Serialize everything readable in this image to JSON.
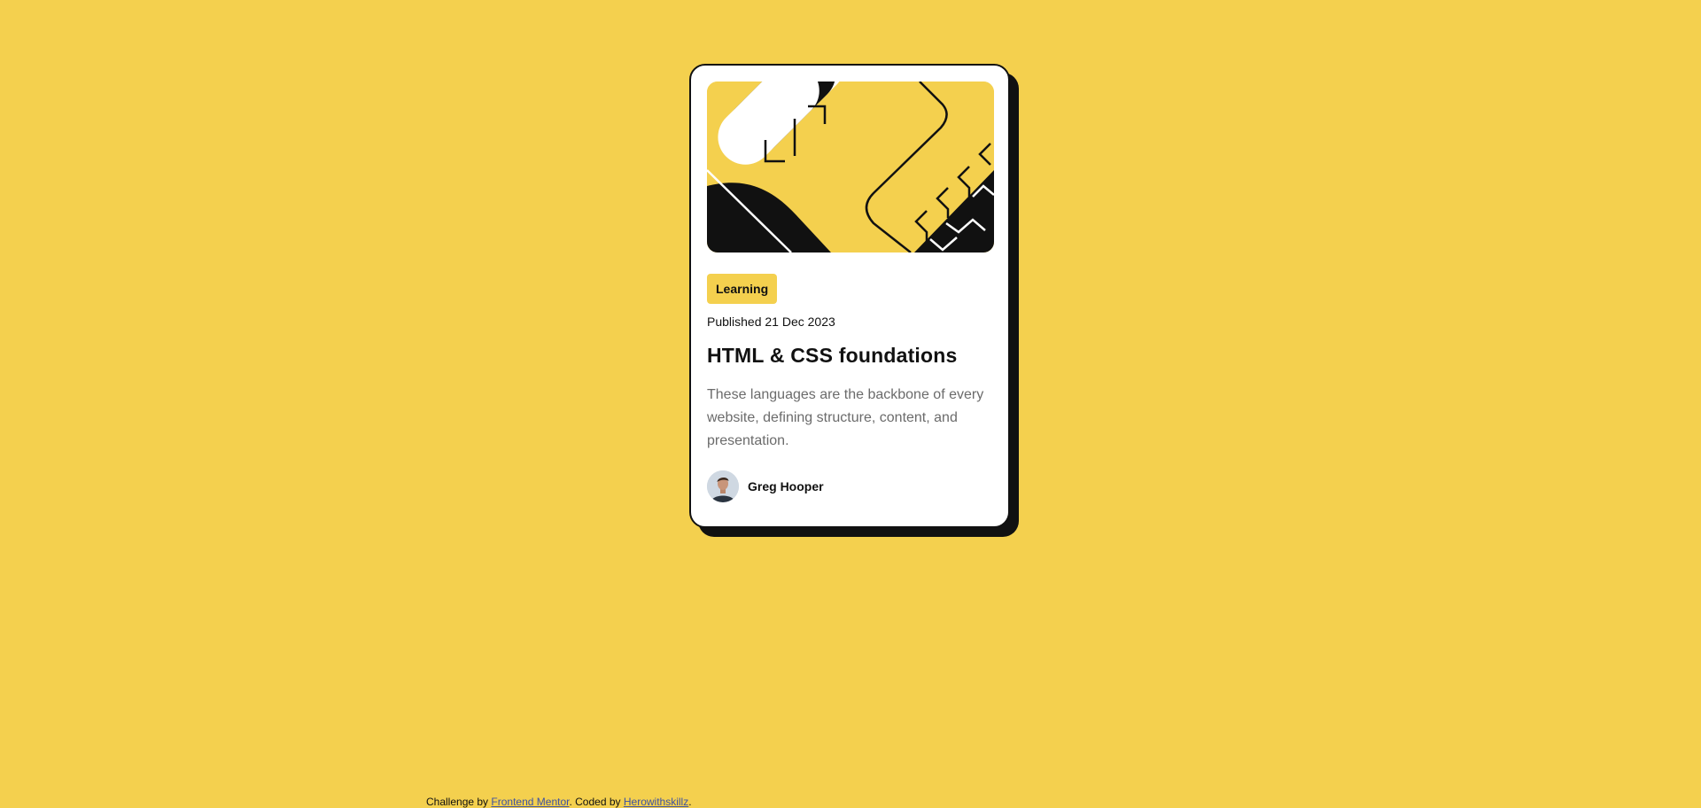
{
  "card": {
    "tag": "Learning",
    "published": "Published 21 Dec 2023",
    "title": "HTML & CSS foundations",
    "description": "These languages are the backbone of every website, defining structure, content, and presentation.",
    "author": {
      "name": "Greg Hooper",
      "avatar_icon": "person-portrait-icon"
    },
    "illustration_icon": "abstract-code-illustration"
  },
  "attribution": {
    "prefix": "Challenge by",
    "link1": "Frontend Mentor",
    "middle": ". Coded by",
    "link2": "Herowithskillz",
    "suffix": "."
  },
  "colors": {
    "background": "#F4D04E",
    "card": "#FFFFFF",
    "ink": "#111111",
    "muted": "#6B6B6B",
    "link": "#3E52A3"
  }
}
